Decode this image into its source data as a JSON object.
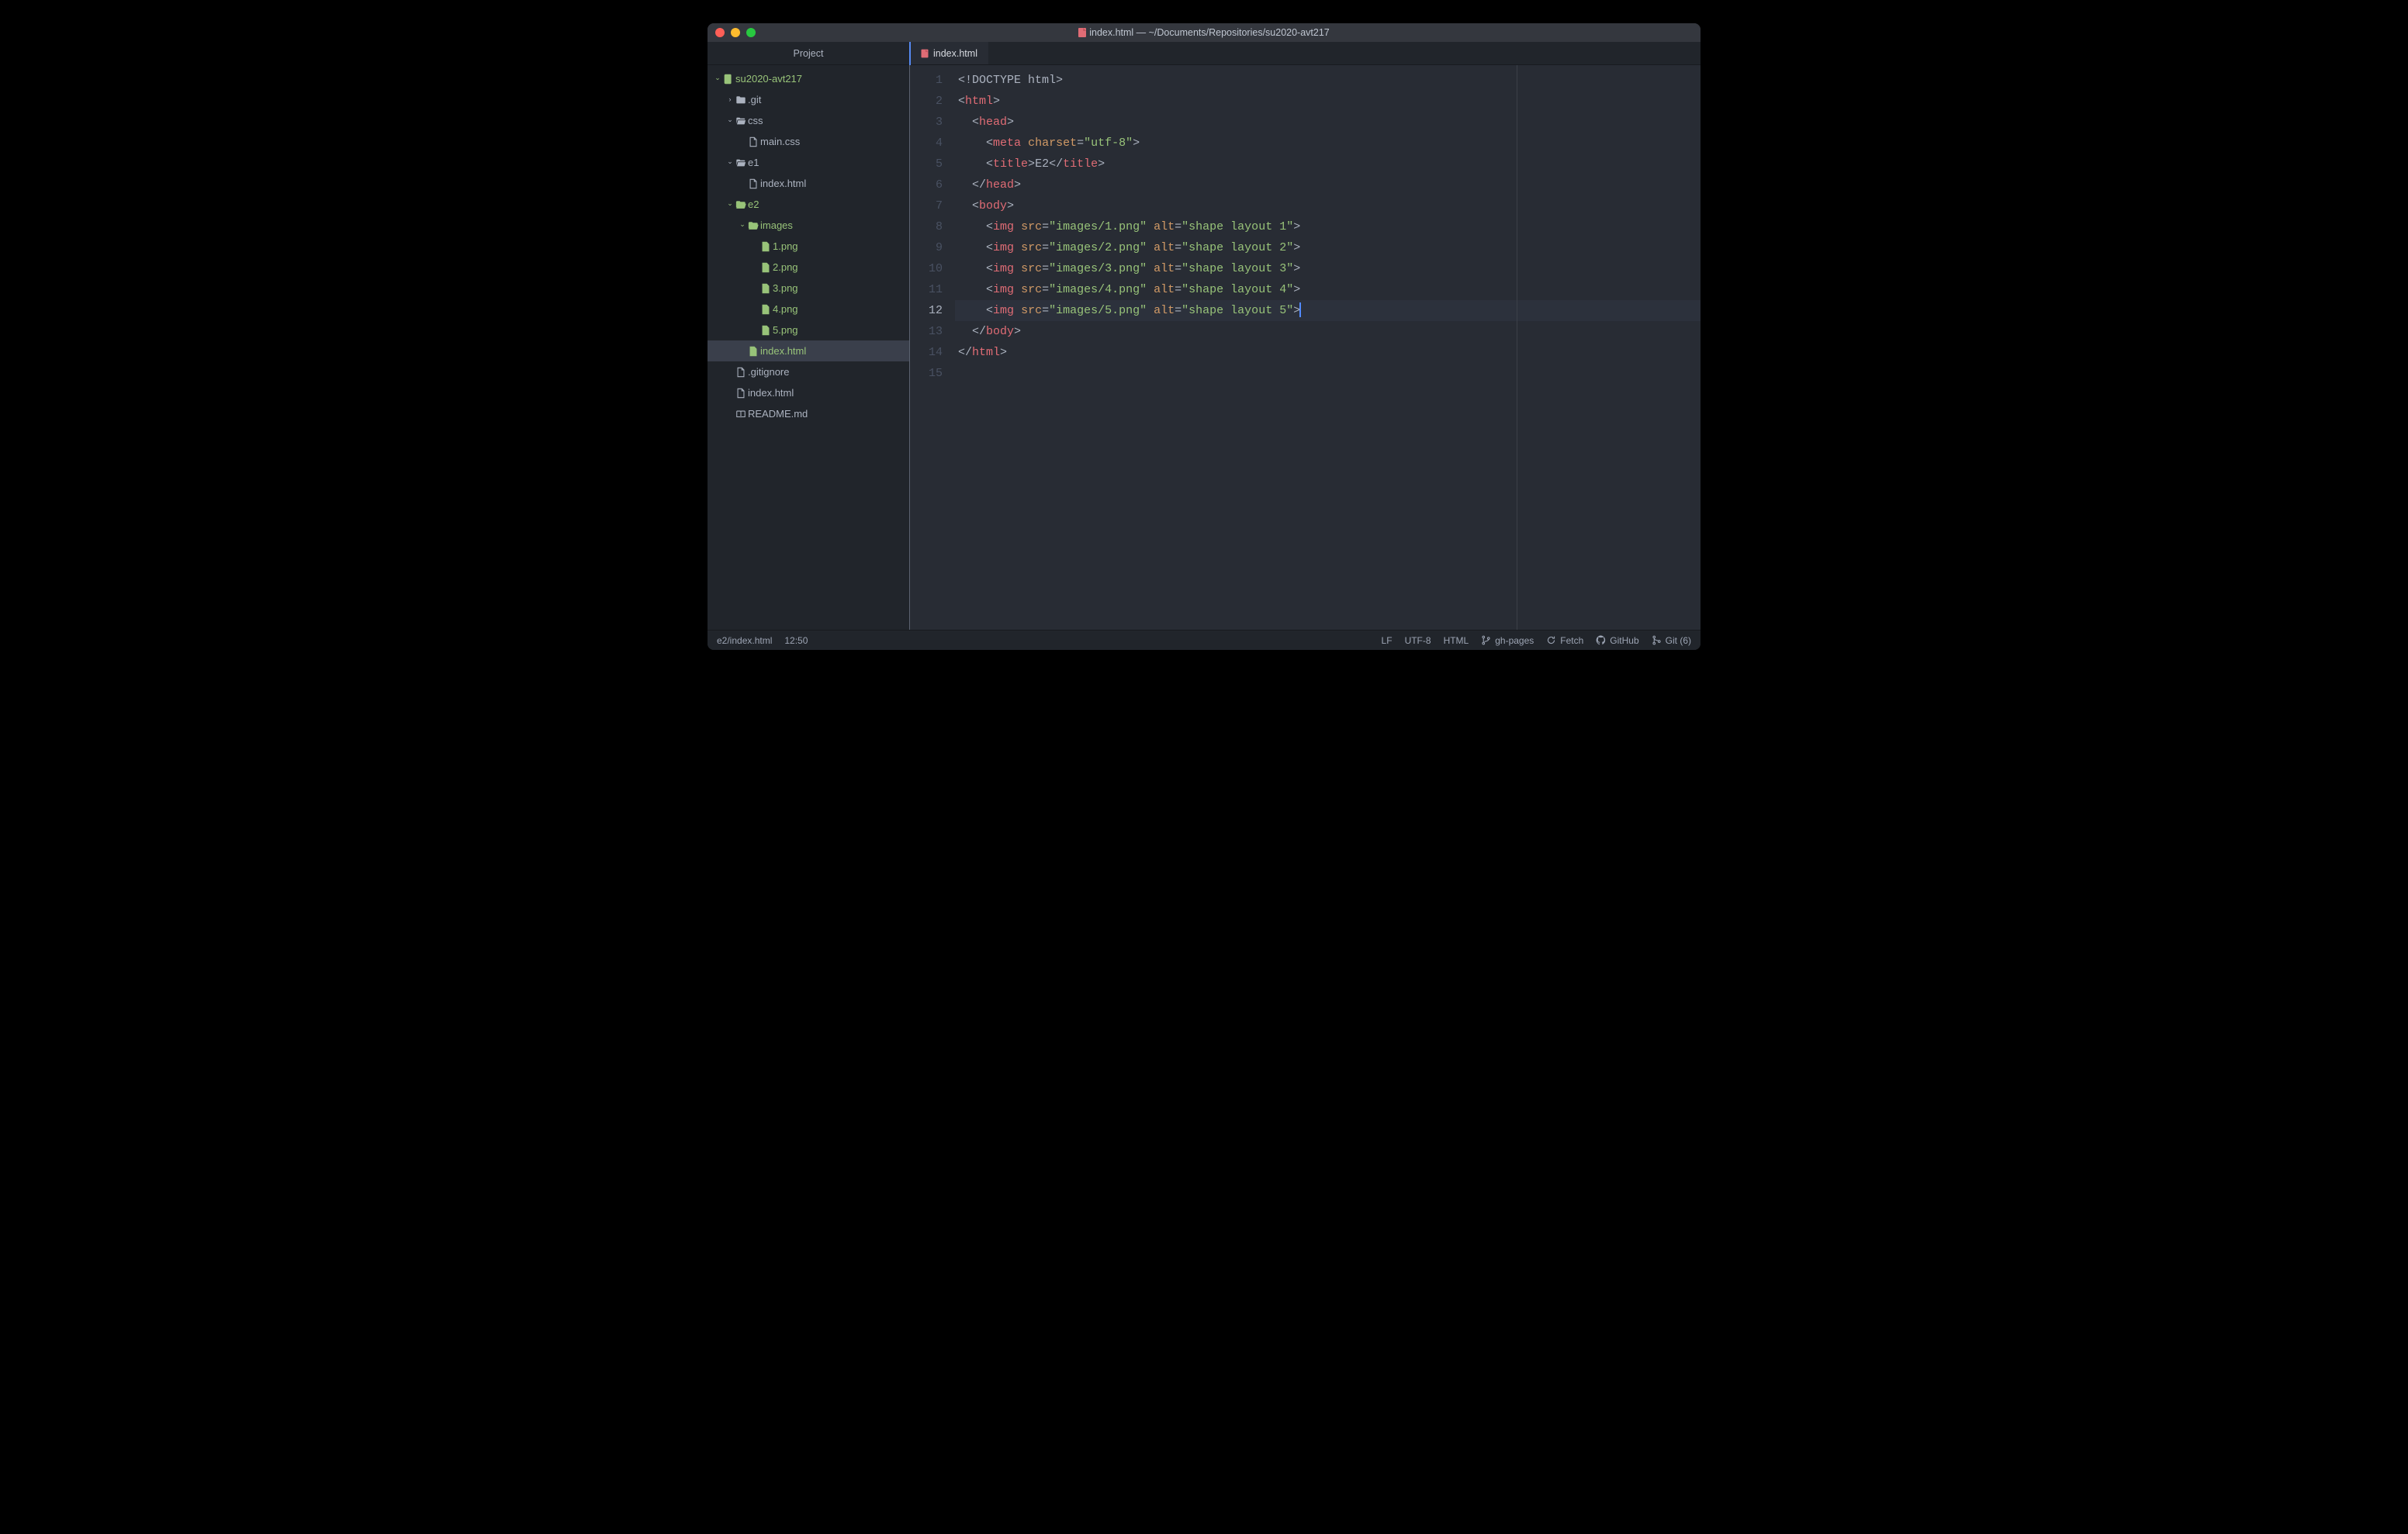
{
  "window": {
    "title": "index.html — ~/Documents/Repositories/su2020-avt217"
  },
  "sidebar": {
    "tab_label": "Project",
    "tree": [
      {
        "depth": 0,
        "caret": "down",
        "icon": "repo",
        "label": "su2020-avt217",
        "green": true
      },
      {
        "depth": 1,
        "caret": "right",
        "icon": "folder-closed",
        "label": ".git"
      },
      {
        "depth": 1,
        "caret": "down",
        "icon": "folder-open",
        "label": "css"
      },
      {
        "depth": 2,
        "icon": "file",
        "label": "main.css"
      },
      {
        "depth": 1,
        "caret": "down",
        "icon": "folder-open",
        "label": "e1"
      },
      {
        "depth": 2,
        "icon": "file",
        "label": "index.html"
      },
      {
        "depth": 1,
        "caret": "down",
        "icon": "folder-open",
        "label": "e2",
        "green": true
      },
      {
        "depth": 2,
        "caret": "down",
        "icon": "folder-open",
        "label": "images",
        "green": true
      },
      {
        "depth": 3,
        "icon": "file",
        "label": "1.png",
        "green": true
      },
      {
        "depth": 3,
        "icon": "file",
        "label": "2.png",
        "green": true
      },
      {
        "depth": 3,
        "icon": "file",
        "label": "3.png",
        "green": true
      },
      {
        "depth": 3,
        "icon": "file",
        "label": "4.png",
        "green": true
      },
      {
        "depth": 3,
        "icon": "file",
        "label": "5.png",
        "green": true
      },
      {
        "depth": 2,
        "icon": "file",
        "label": "index.html",
        "green": true,
        "active": true
      },
      {
        "depth": 1,
        "icon": "file",
        "label": ".gitignore"
      },
      {
        "depth": 1,
        "icon": "file",
        "label": "index.html"
      },
      {
        "depth": 1,
        "icon": "readme",
        "label": "README.md"
      }
    ]
  },
  "editor": {
    "tab_label": "index.html",
    "lines": [
      {
        "n": 1,
        "tokens": [
          {
            "c": "c-punct",
            "t": "<"
          },
          {
            "c": "c-doctype",
            "t": "!DOCTYPE html"
          },
          {
            "c": "c-punct",
            "t": ">"
          }
        ]
      },
      {
        "n": 2,
        "tokens": [
          {
            "c": "c-punct",
            "t": "<"
          },
          {
            "c": "c-tag",
            "t": "html"
          },
          {
            "c": "c-punct",
            "t": ">"
          }
        ]
      },
      {
        "n": 3,
        "indent": "  ",
        "tokens": [
          {
            "c": "c-punct",
            "t": "<"
          },
          {
            "c": "c-tag",
            "t": "head"
          },
          {
            "c": "c-punct",
            "t": ">"
          }
        ]
      },
      {
        "n": 4,
        "indent": "    ",
        "tokens": [
          {
            "c": "c-punct",
            "t": "<"
          },
          {
            "c": "c-tag",
            "t": "meta"
          },
          {
            "c": "",
            "t": " "
          },
          {
            "c": "c-attr",
            "t": "charset"
          },
          {
            "c": "c-punct",
            "t": "="
          },
          {
            "c": "c-str",
            "t": "\"utf-8\""
          },
          {
            "c": "c-punct",
            "t": ">"
          }
        ]
      },
      {
        "n": 5,
        "indent": "    ",
        "tokens": [
          {
            "c": "c-punct",
            "t": "<"
          },
          {
            "c": "c-tag",
            "t": "title"
          },
          {
            "c": "c-punct",
            "t": ">"
          },
          {
            "c": "c-title",
            "t": "E2"
          },
          {
            "c": "c-punct",
            "t": "</"
          },
          {
            "c": "c-tag",
            "t": "title"
          },
          {
            "c": "c-punct",
            "t": ">"
          }
        ]
      },
      {
        "n": 6,
        "indent": "  ",
        "tokens": [
          {
            "c": "c-punct",
            "t": "</"
          },
          {
            "c": "c-tag",
            "t": "head"
          },
          {
            "c": "c-punct",
            "t": ">"
          }
        ]
      },
      {
        "n": 7,
        "indent": "  ",
        "tokens": [
          {
            "c": "c-punct",
            "t": "<"
          },
          {
            "c": "c-tag",
            "t": "body"
          },
          {
            "c": "c-punct",
            "t": ">"
          }
        ]
      },
      {
        "n": 8,
        "indent": "    ",
        "tokens": [
          {
            "c": "c-punct",
            "t": "<"
          },
          {
            "c": "c-tag",
            "t": "img"
          },
          {
            "c": "",
            "t": " "
          },
          {
            "c": "c-attr",
            "t": "src"
          },
          {
            "c": "c-punct",
            "t": "="
          },
          {
            "c": "c-str",
            "t": "\"images/1.png\""
          },
          {
            "c": "",
            "t": " "
          },
          {
            "c": "c-attr",
            "t": "alt"
          },
          {
            "c": "c-punct",
            "t": "="
          },
          {
            "c": "c-str",
            "t": "\"shape layout 1\""
          },
          {
            "c": "c-punct",
            "t": ">"
          }
        ]
      },
      {
        "n": 9,
        "indent": "    ",
        "tokens": [
          {
            "c": "c-punct",
            "t": "<"
          },
          {
            "c": "c-tag",
            "t": "img"
          },
          {
            "c": "",
            "t": " "
          },
          {
            "c": "c-attr",
            "t": "src"
          },
          {
            "c": "c-punct",
            "t": "="
          },
          {
            "c": "c-str",
            "t": "\"images/2.png\""
          },
          {
            "c": "",
            "t": " "
          },
          {
            "c": "c-attr",
            "t": "alt"
          },
          {
            "c": "c-punct",
            "t": "="
          },
          {
            "c": "c-str",
            "t": "\"shape layout 2\""
          },
          {
            "c": "c-punct",
            "t": ">"
          }
        ]
      },
      {
        "n": 10,
        "indent": "    ",
        "tokens": [
          {
            "c": "c-punct",
            "t": "<"
          },
          {
            "c": "c-tag",
            "t": "img"
          },
          {
            "c": "",
            "t": " "
          },
          {
            "c": "c-attr",
            "t": "src"
          },
          {
            "c": "c-punct",
            "t": "="
          },
          {
            "c": "c-str",
            "t": "\"images/3.png\""
          },
          {
            "c": "",
            "t": " "
          },
          {
            "c": "c-attr",
            "t": "alt"
          },
          {
            "c": "c-punct",
            "t": "="
          },
          {
            "c": "c-str",
            "t": "\"shape layout 3\""
          },
          {
            "c": "c-punct",
            "t": ">"
          }
        ]
      },
      {
        "n": 11,
        "indent": "    ",
        "tokens": [
          {
            "c": "c-punct",
            "t": "<"
          },
          {
            "c": "c-tag",
            "t": "img"
          },
          {
            "c": "",
            "t": " "
          },
          {
            "c": "c-attr",
            "t": "src"
          },
          {
            "c": "c-punct",
            "t": "="
          },
          {
            "c": "c-str",
            "t": "\"images/4.png\""
          },
          {
            "c": "",
            "t": " "
          },
          {
            "c": "c-attr",
            "t": "alt"
          },
          {
            "c": "c-punct",
            "t": "="
          },
          {
            "c": "c-str",
            "t": "\"shape layout 4\""
          },
          {
            "c": "c-punct",
            "t": ">"
          }
        ]
      },
      {
        "n": 12,
        "hl": true,
        "indent": "    ",
        "tokens": [
          {
            "c": "c-punct",
            "t": "<"
          },
          {
            "c": "c-tag",
            "t": "img"
          },
          {
            "c": "",
            "t": " "
          },
          {
            "c": "c-attr",
            "t": "src"
          },
          {
            "c": "c-punct",
            "t": "="
          },
          {
            "c": "c-str",
            "t": "\"images/5.png\""
          },
          {
            "c": "",
            "t": " "
          },
          {
            "c": "c-attr",
            "t": "alt"
          },
          {
            "c": "c-punct",
            "t": "="
          },
          {
            "c": "c-str",
            "t": "\"shape layout 5\""
          },
          {
            "c": "c-punct",
            "t": ">"
          }
        ],
        "cursor": true
      },
      {
        "n": 13,
        "indent": "  ",
        "tokens": [
          {
            "c": "c-punct",
            "t": "</"
          },
          {
            "c": "c-tag",
            "t": "body"
          },
          {
            "c": "c-punct",
            "t": ">"
          }
        ]
      },
      {
        "n": 14,
        "tokens": [
          {
            "c": "c-punct",
            "t": "</"
          },
          {
            "c": "c-tag",
            "t": "html"
          },
          {
            "c": "c-punct",
            "t": ">"
          }
        ]
      },
      {
        "n": 15,
        "tokens": []
      }
    ]
  },
  "statusbar": {
    "path": "e2/index.html",
    "cursor": "12:50",
    "line_ending": "LF",
    "encoding": "UTF-8",
    "language": "HTML",
    "branch": "gh-pages",
    "fetch": "Fetch",
    "github": "GitHub",
    "git_count": "Git (6)"
  }
}
